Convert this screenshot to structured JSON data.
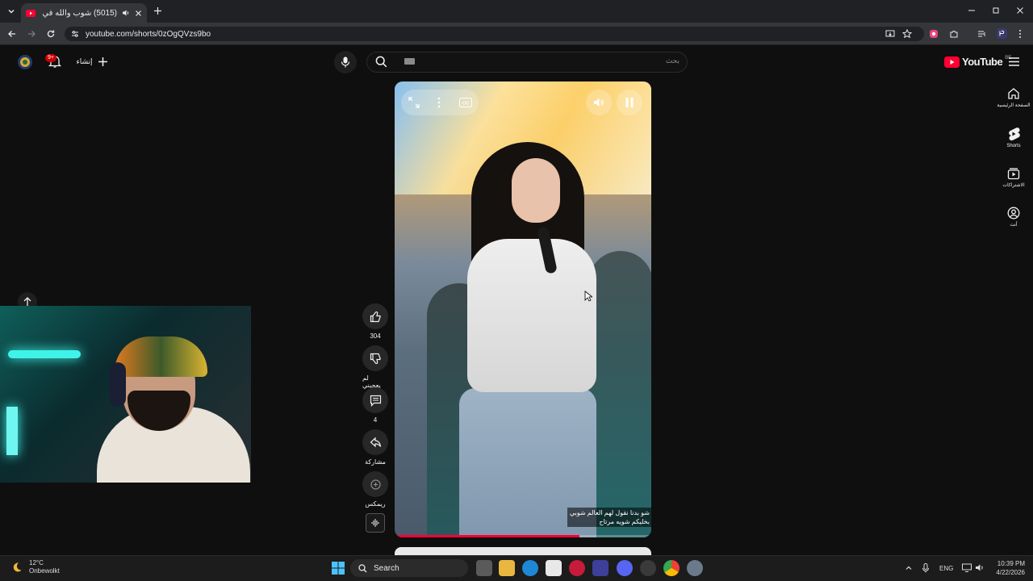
{
  "browser": {
    "tab_title": "(5015) شوب والله في عالم ...",
    "url": "youtube.com/shorts/0zOgQVzs9bo"
  },
  "youtube": {
    "logo_text": "YouTube",
    "region": "BE",
    "search_placeholder": "بحث",
    "create_label": "إنشاء",
    "notification_count": "9+",
    "rail": [
      {
        "label": "الصفحة الرئيسية",
        "icon": "home-icon"
      },
      {
        "label": "Shorts",
        "icon": "shorts-icon"
      },
      {
        "label": "الاشتراكات",
        "icon": "subscriptions-icon"
      },
      {
        "label": "أنت",
        "icon": "you-icon"
      }
    ]
  },
  "short": {
    "caption_lines": [
      "شو بدنا نقول لهم العالم شوبي",
      "بخليكم شويه مرتاح"
    ],
    "progress": 0.72,
    "actions": {
      "like_count": "304",
      "dislike_label": "لم يعجبني",
      "comment_count": "4",
      "share_label": "مشاركة",
      "remix_label": "ريمكس"
    }
  },
  "taskbar": {
    "temperature": "12°C",
    "weather": "Onbewolkt",
    "search_label": "Search",
    "language": "ENG",
    "time": "10:39 PM",
    "date": "4/22/2026"
  }
}
